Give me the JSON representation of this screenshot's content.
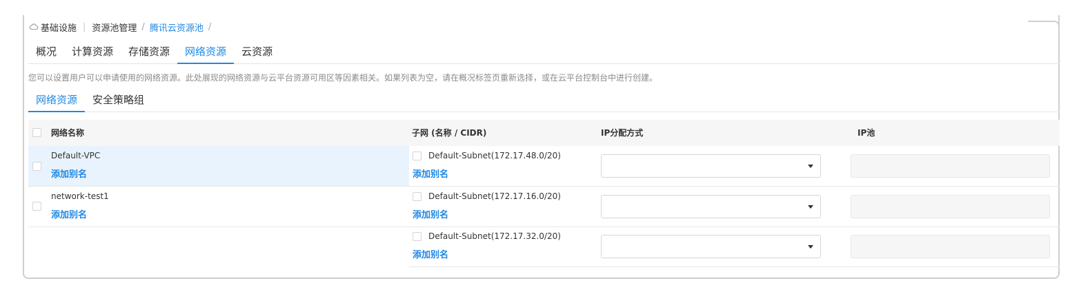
{
  "breadcrumb": {
    "home_icon": "cloud-icon",
    "items": [
      "基础设施",
      "资源池管理",
      "腾讯云资源池"
    ],
    "trailing_separator": "/"
  },
  "main_tabs": [
    {
      "label": "概况",
      "active": false
    },
    {
      "label": "计算资源",
      "active": false
    },
    {
      "label": "存储资源",
      "active": false
    },
    {
      "label": "网络资源",
      "active": true
    },
    {
      "label": "云资源",
      "active": false
    }
  ],
  "hint": "您可以设置用户可以申请使用的网络资源。此处展现的网络资源与云平台资源可用区等因素相关。如果列表为空，请在概况标签页重新选择，或在云平台控制台中进行创建。",
  "sub_tabs": [
    {
      "label": "网络资源",
      "active": true
    },
    {
      "label": "安全策略组",
      "active": false
    }
  ],
  "table": {
    "headers": {
      "network": "网络名称",
      "subnet": "子网 (名称 / CIDR)",
      "ip_mode": "IP分配方式",
      "ip_pool": "IP池"
    },
    "alias_label": "添加别名",
    "networks": [
      {
        "name": "Default-VPC",
        "alias": "添加别名"
      },
      {
        "name": "network-test1",
        "alias": "添加别名"
      }
    ],
    "subnets": [
      {
        "name": "Default-Subnet(172.17.48.0/20)",
        "alias": "添加别名",
        "ip_mode": "",
        "ip_pool": ""
      },
      {
        "name": "Default-Subnet(172.17.16.0/20)",
        "alias": "添加别名",
        "ip_mode": "",
        "ip_pool": ""
      },
      {
        "name": "Default-Subnet(172.17.32.0/20)",
        "alias": "添加别名",
        "ip_mode": "",
        "ip_pool": ""
      }
    ]
  },
  "colors": {
    "accent": "#1e88e5",
    "highlight_row": "#e8f3fe",
    "header_bg": "#f6f6f6"
  }
}
